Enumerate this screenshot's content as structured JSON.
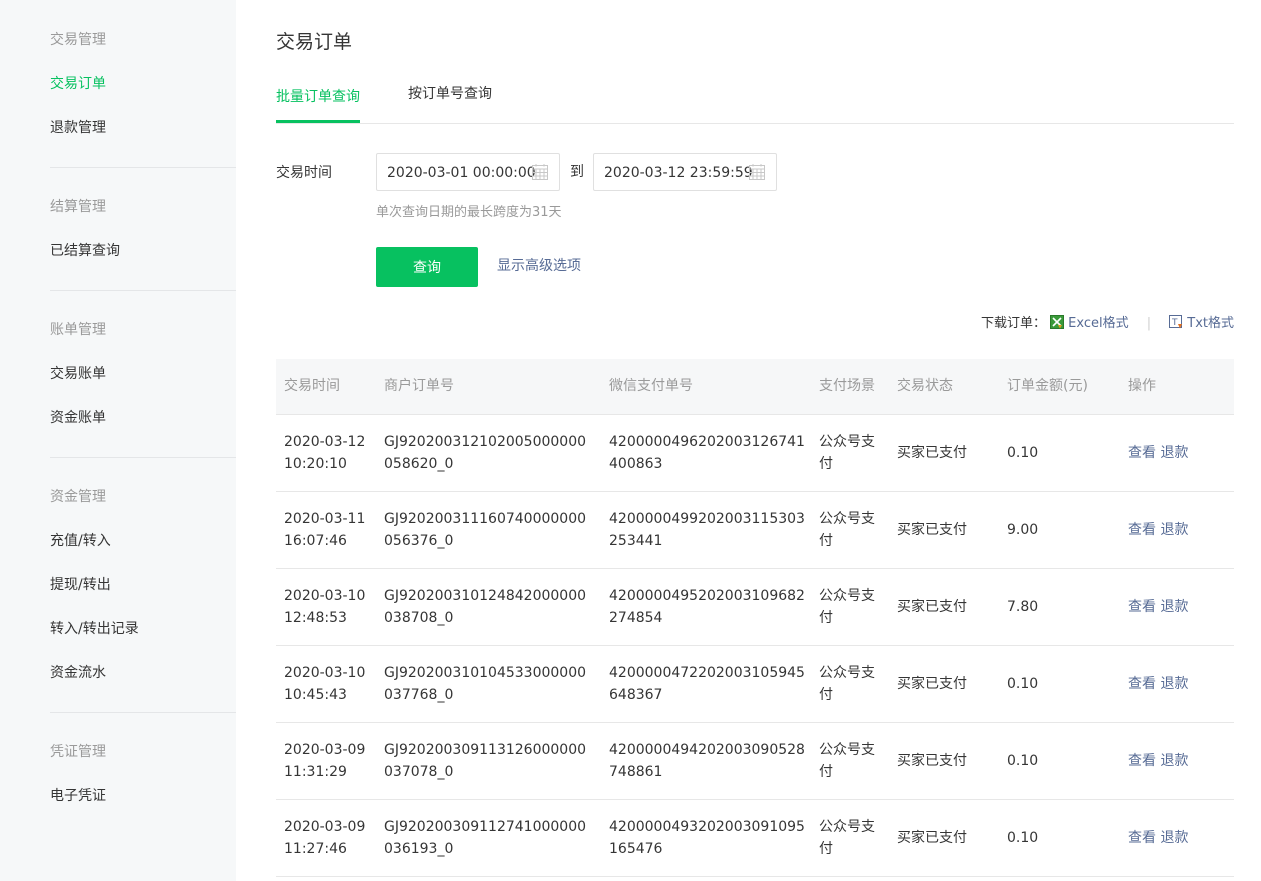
{
  "sidebar": {
    "groups": [
      {
        "title": "交易管理",
        "items": [
          "交易订单",
          "退款管理"
        ]
      },
      {
        "title": "结算管理",
        "items": [
          "已结算查询"
        ]
      },
      {
        "title": "账单管理",
        "items": [
          "交易账单",
          "资金账单"
        ]
      },
      {
        "title": "资金管理",
        "items": [
          "充值/转入",
          "提现/转出",
          "转入/转出记录",
          "资金流水"
        ]
      },
      {
        "title": "凭证管理",
        "items": [
          "电子凭证"
        ]
      }
    ],
    "active_item": "交易订单"
  },
  "page": {
    "title": "交易订单",
    "tabs": [
      "批量订单查询",
      "按订单号查询"
    ],
    "active_tab": 0
  },
  "filter": {
    "time_label": "交易时间",
    "start": "2020-03-01 00:00:00",
    "to_label": "到",
    "end": "2020-03-12 23:59:59",
    "hint": "单次查询日期的最长跨度为31天",
    "query_button": "查询",
    "advanced_link": "显示高级选项"
  },
  "download": {
    "label": "下载订单：",
    "excel": "Excel格式",
    "txt": "Txt格式"
  },
  "table": {
    "columns": [
      "交易时间",
      "商户订单号",
      "微信支付单号",
      "支付场景",
      "交易状态",
      "订单金额(元)",
      "操作"
    ],
    "rows": [
      {
        "time": "2020-03-12 10:20:10",
        "mch_no": "GJ920200312102005000000058620_0",
        "wx_no": "4200000496202003126741400863",
        "scene": "公众号支付",
        "status": "买家已支付",
        "amount": "0.10",
        "op_view": "查看",
        "op_refund": "退款"
      },
      {
        "time": "2020-03-11 16:07:46",
        "mch_no": "GJ920200311160740000000056376_0",
        "wx_no": "4200000499202003115303253441",
        "scene": "公众号支付",
        "status": "买家已支付",
        "amount": "9.00",
        "op_view": "查看",
        "op_refund": "退款"
      },
      {
        "time": "2020-03-10 12:48:53",
        "mch_no": "GJ920200310124842000000038708_0",
        "wx_no": "4200000495202003109682274854",
        "scene": "公众号支付",
        "status": "买家已支付",
        "amount": "7.80",
        "op_view": "查看",
        "op_refund": "退款"
      },
      {
        "time": "2020-03-10 10:45:43",
        "mch_no": "GJ920200310104533000000037768_0",
        "wx_no": "4200000472202003105945648367",
        "scene": "公众号支付",
        "status": "买家已支付",
        "amount": "0.10",
        "op_view": "查看",
        "op_refund": "退款"
      },
      {
        "time": "2020-03-09 11:31:29",
        "mch_no": "GJ920200309113126000000037078_0",
        "wx_no": "4200000494202003090528748861",
        "scene": "公众号支付",
        "status": "买家已支付",
        "amount": "0.10",
        "op_view": "查看",
        "op_refund": "退款"
      },
      {
        "time": "2020-03-09 11:27:46",
        "mch_no": "GJ920200309112741000000036193_0",
        "wx_no": "4200000493202003091095165476",
        "scene": "公众号支付",
        "status": "买家已支付",
        "amount": "0.10",
        "op_view": "查看",
        "op_refund": "退款"
      }
    ]
  },
  "colors": {
    "accent": "#07c160",
    "link": "#576b95",
    "muted": "#9a9a9a",
    "text": "#353535",
    "sidebar_bg": "#f6f8f9"
  },
  "icons": [
    "calendar-icon",
    "excel-file-icon",
    "txt-file-icon"
  ]
}
